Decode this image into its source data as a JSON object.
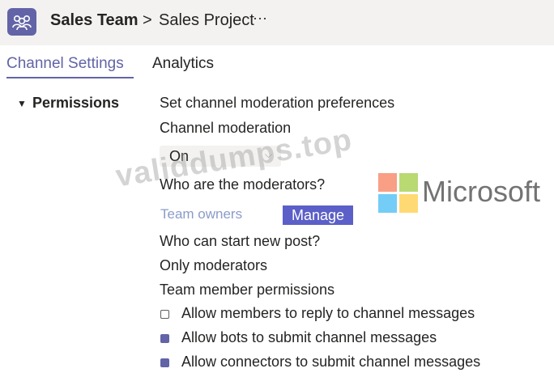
{
  "breadcrumb": {
    "team": "Sales Team",
    "separator": ">",
    "channel": "Sales Project",
    "more": "···"
  },
  "tabs": [
    {
      "label": "Channel Settings",
      "active": true
    },
    {
      "label": "Analytics",
      "active": false
    }
  ],
  "permissions": {
    "section_label": "Permissions",
    "moderation_heading": "Set channel moderation preferences",
    "moderation_label": "Channel moderation",
    "moderation_value": "On",
    "moderators_question": "Who are the moderators?",
    "moderators_value": "Team owners",
    "manage_label": "Manage",
    "post_question": "Who can start new post?",
    "post_value": "Only moderators",
    "member_permissions_label": "Team member permissions",
    "options": [
      {
        "label": "Allow members to reply to channel messages",
        "checked": false
      },
      {
        "label": "Allow bots to submit channel messages",
        "checked": true
      },
      {
        "label": "Allow connectors to submit channel messages",
        "checked": true
      }
    ]
  },
  "overlay": {
    "watermark": "validdumps.top",
    "logo_word": "Microsoft",
    "logo_colors": [
      "#f25022",
      "#7fba00",
      "#00a4ef",
      "#ffb900"
    ]
  },
  "colors": {
    "accent": "#6264a7",
    "button": "#5b5fc7"
  }
}
